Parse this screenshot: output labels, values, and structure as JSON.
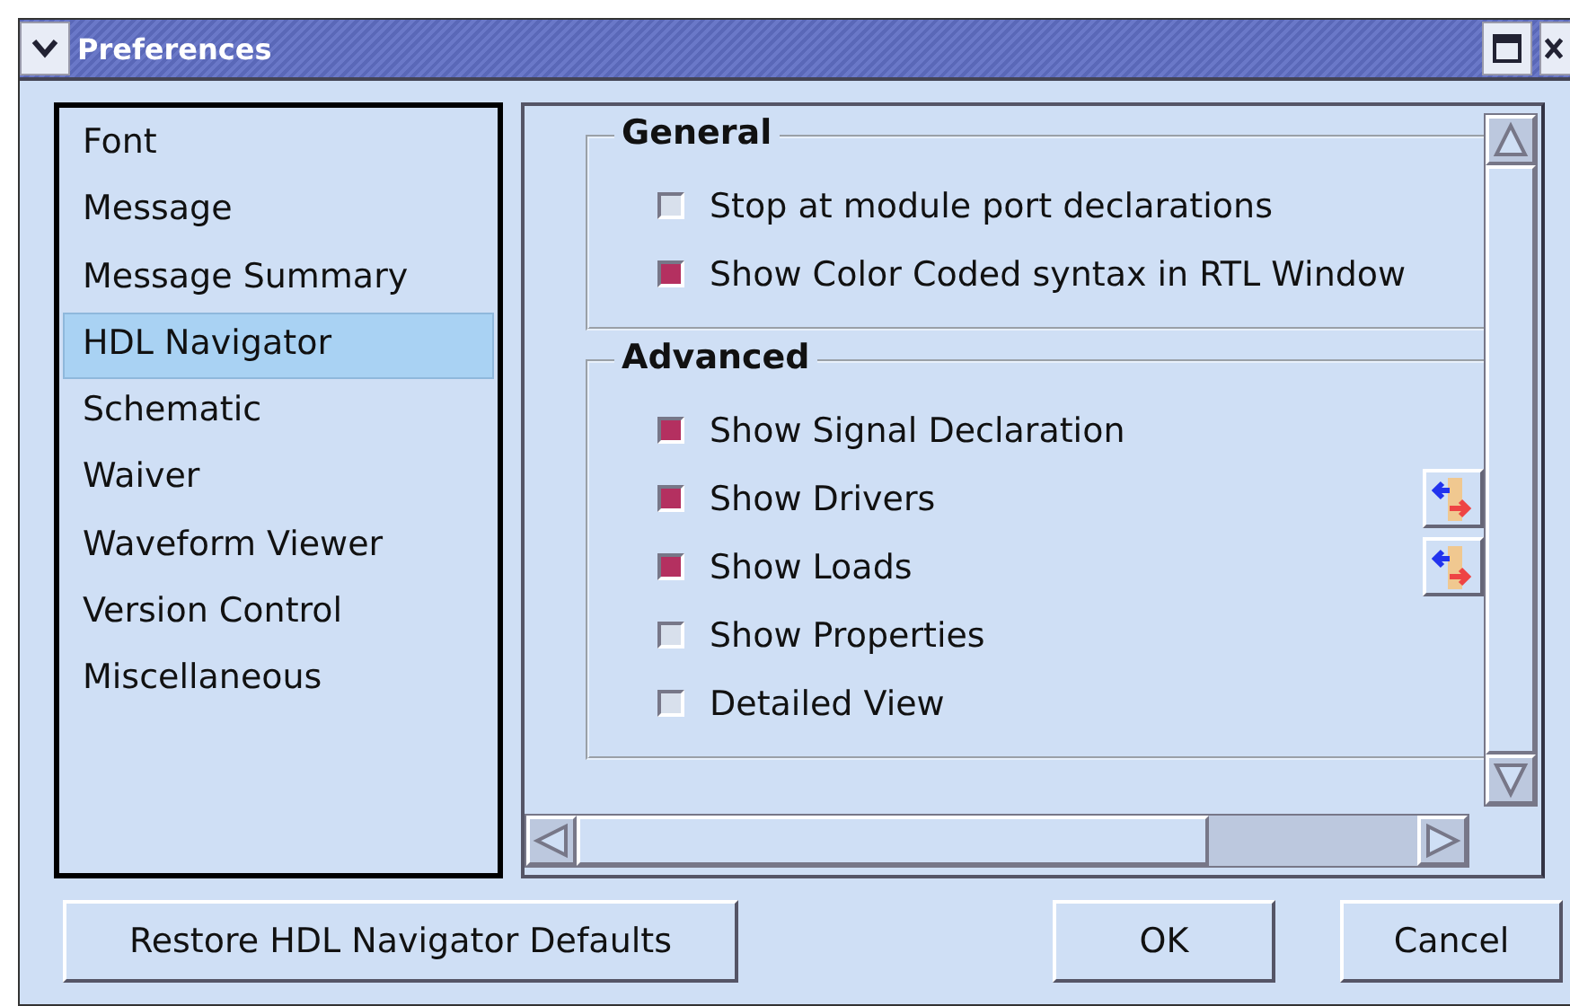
{
  "window": {
    "title": "Preferences"
  },
  "sidebar": {
    "items": [
      {
        "label": "Font",
        "selected": false
      },
      {
        "label": "Message",
        "selected": false
      },
      {
        "label": "Message Summary",
        "selected": false
      },
      {
        "label": "HDL Navigator",
        "selected": true
      },
      {
        "label": "Schematic",
        "selected": false
      },
      {
        "label": "Waiver",
        "selected": false
      },
      {
        "label": "Waveform Viewer",
        "selected": false
      },
      {
        "label": "Version Control",
        "selected": false
      },
      {
        "label": "Miscellaneous",
        "selected": false
      }
    ]
  },
  "groups": [
    {
      "title": "General",
      "options": [
        {
          "label": "Stop at module port declarations",
          "checked": false,
          "tool_button": false
        },
        {
          "label": "Show Color Coded syntax in RTL Window",
          "checked": true,
          "tool_button": false
        }
      ]
    },
    {
      "title": "Advanced",
      "options": [
        {
          "label": "Show Signal Declaration",
          "checked": true,
          "tool_button": false
        },
        {
          "label": "Show Drivers",
          "checked": true,
          "tool_button": true
        },
        {
          "label": "Show Loads",
          "checked": true,
          "tool_button": true
        },
        {
          "label": "Show Properties",
          "checked": false,
          "tool_button": false
        },
        {
          "label": "Detailed View",
          "checked": false,
          "tool_button": false
        }
      ]
    }
  ],
  "buttons": {
    "restore": "Restore HDL Navigator Defaults",
    "ok": "OK",
    "cancel": "Cancel"
  }
}
